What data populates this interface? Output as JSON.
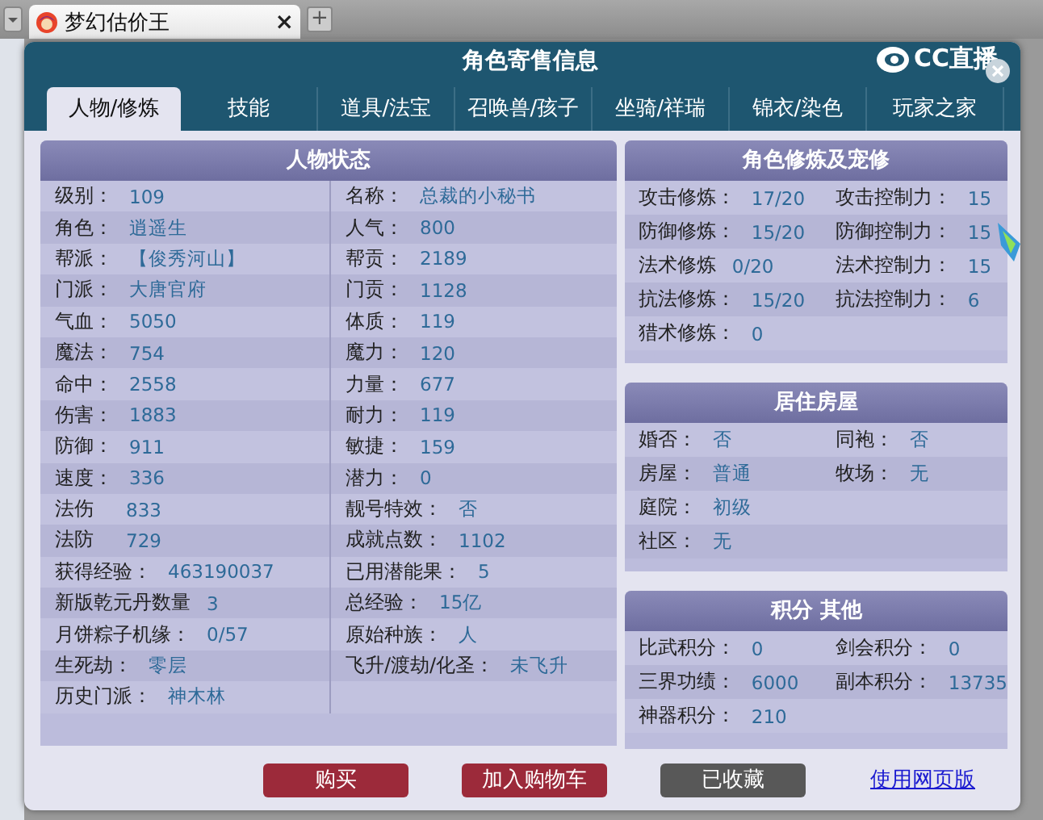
{
  "browser": {
    "tab_title": "梦幻估价王",
    "close": "×",
    "new_tab": "+"
  },
  "dialog": {
    "title": "角色寄售信息",
    "logo": "CC直播"
  },
  "tabs": [
    {
      "label": "人物/修炼",
      "selected": true
    },
    {
      "label": "技能",
      "selected": false
    },
    {
      "label": "道具/法宝",
      "selected": false
    },
    {
      "label": "召唤兽/孩子",
      "selected": false
    },
    {
      "label": "坐骑/祥瑞",
      "selected": false
    },
    {
      "label": "锦衣/染色",
      "selected": false
    },
    {
      "label": "玩家之家",
      "selected": false
    }
  ],
  "status_panel": {
    "title": "人物状态",
    "rows": [
      [
        {
          "label": "级别：",
          "value": "109"
        },
        {
          "label": "名称：",
          "value": "总裁的小秘书"
        }
      ],
      [
        {
          "label": "角色：",
          "value": "逍遥生"
        },
        {
          "label": "人气：",
          "value": "800"
        }
      ],
      [
        {
          "label": "帮派：",
          "value": "【俊秀河山】"
        },
        {
          "label": "帮贡：",
          "value": "2189"
        }
      ],
      [
        {
          "label": "门派：",
          "value": "大唐官府"
        },
        {
          "label": "门贡：",
          "value": "1128"
        }
      ],
      [
        {
          "label": "气血：",
          "value": "5050"
        },
        {
          "label": "体质：",
          "value": "119"
        }
      ],
      [
        {
          "label": "魔法：",
          "value": "754"
        },
        {
          "label": "魔力：",
          "value": "120"
        }
      ],
      [
        {
          "label": "命中：",
          "value": "2558"
        },
        {
          "label": "力量：",
          "value": "677"
        }
      ],
      [
        {
          "label": "伤害：",
          "value": "1883"
        },
        {
          "label": "耐力：",
          "value": "119"
        }
      ],
      [
        {
          "label": "防御：",
          "value": "911"
        },
        {
          "label": "敏捷：",
          "value": "159"
        }
      ],
      [
        {
          "label": "速度：",
          "value": "336"
        },
        {
          "label": "潜力：",
          "value": "0"
        }
      ],
      [
        {
          "label": "法伤",
          "value": "833"
        },
        {
          "label": "靓号特效：",
          "value": "否"
        }
      ],
      [
        {
          "label": "法防",
          "value": "729"
        },
        {
          "label": "成就点数：",
          "value": "1102"
        }
      ],
      [
        {
          "label": "获得经验：",
          "value": "463190037"
        },
        {
          "label": "已用潜能果：",
          "value": "5"
        }
      ],
      [
        {
          "label": "新版乾元丹数量",
          "value": "3"
        },
        {
          "label": "总经验：",
          "value": "15亿"
        }
      ],
      [
        {
          "label": "月饼粽子机缘：",
          "value": "0/57"
        },
        {
          "label": "原始种族：",
          "value": "人"
        }
      ],
      [
        {
          "label": "生死劫：",
          "value": "零层"
        },
        {
          "label": "飞升/渡劫/化圣：",
          "value": "未飞升"
        }
      ],
      [
        {
          "label": "历史门派：",
          "value": "神木林"
        }
      ]
    ]
  },
  "side_panels": [
    {
      "title": "角色修炼及宠修",
      "rows": [
        [
          {
            "label": "攻击修炼：",
            "value": "17/20"
          },
          {
            "label": "攻击控制力：",
            "value": "15"
          }
        ],
        [
          {
            "label": "防御修炼：",
            "value": "15/20"
          },
          {
            "label": "防御控制力：",
            "value": "15"
          }
        ],
        [
          {
            "label": "法术修炼",
            "value": "0/20"
          },
          {
            "label": "法术控制力：",
            "value": "15"
          }
        ],
        [
          {
            "label": "抗法修炼：",
            "value": "15/20"
          },
          {
            "label": "抗法控制力：",
            "value": "6"
          }
        ],
        [
          {
            "label": "猎术修炼：",
            "value": "0"
          }
        ]
      ]
    },
    {
      "title": "居住房屋",
      "rows": [
        [
          {
            "label": "婚否：",
            "value": "否"
          },
          {
            "label": "同袍：",
            "value": "否"
          }
        ],
        [
          {
            "label": "房屋：",
            "value": "普通"
          },
          {
            "label": "牧场：",
            "value": "无"
          }
        ],
        [
          {
            "label": "庭院：",
            "value": "初级"
          }
        ],
        [
          {
            "label": "社区：",
            "value": "无"
          }
        ]
      ]
    },
    {
      "title": "积分 其他",
      "rows": [
        [
          {
            "label": "比武积分：",
            "value": "0"
          },
          {
            "label": "剑会积分：",
            "value": "0"
          }
        ],
        [
          {
            "label": "三界功绩：",
            "value": "6000"
          },
          {
            "label": "副本积分：",
            "value": "13735"
          }
        ],
        [
          {
            "label": "神器积分：",
            "value": "210"
          }
        ]
      ]
    }
  ],
  "buttons": [
    {
      "label": "购买",
      "kind": "primary"
    },
    {
      "label": "加入购物车",
      "kind": "primary"
    },
    {
      "label": "已收藏",
      "kind": "muted"
    }
  ],
  "link": "使用网页版"
}
